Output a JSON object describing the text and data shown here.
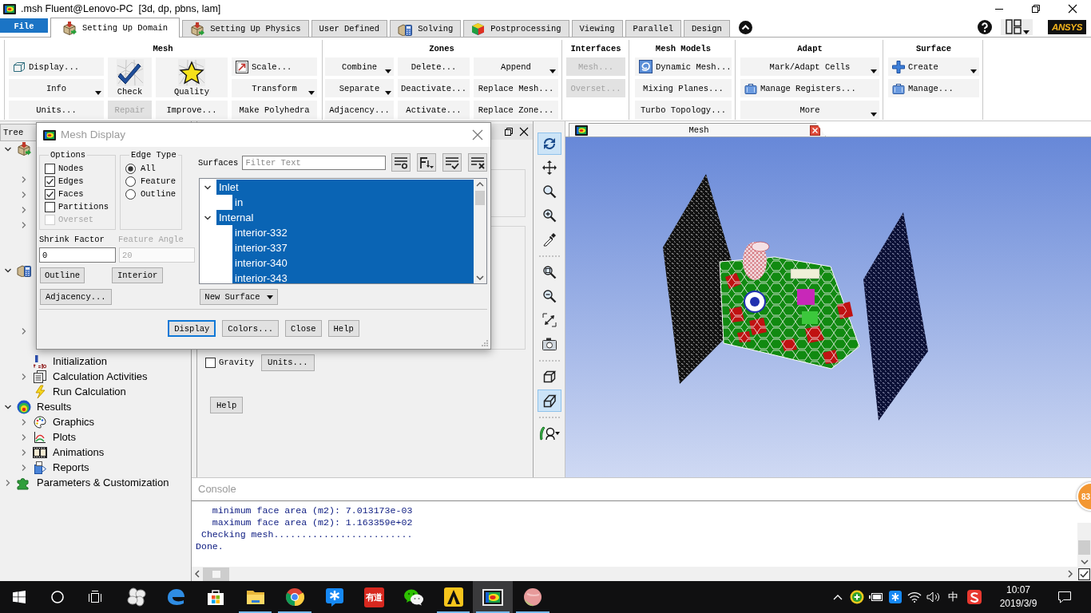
{
  "window": {
    "title": ".msh Fluent@Lenovo-PC  [3d, dp, pbns, lam]"
  },
  "ribbon_tabs": [
    {
      "label": "File",
      "kind": "file",
      "selected": false
    },
    {
      "label": "Setting Up Domain",
      "kind": "tab",
      "selected": true
    },
    {
      "label": "Setting Up Physics",
      "kind": "tab",
      "selected": false
    },
    {
      "label": "User Defined",
      "kind": "tab",
      "selected": false
    },
    {
      "label": "Solving",
      "kind": "tab",
      "selected": false
    },
    {
      "label": "Postprocessing",
      "kind": "tab",
      "selected": false
    },
    {
      "label": "Viewing",
      "kind": "tab",
      "selected": false
    },
    {
      "label": "Parallel",
      "kind": "tab",
      "selected": false
    },
    {
      "label": "Design",
      "kind": "tab",
      "selected": false
    }
  ],
  "logo": "ANSYS",
  "ribbon_groups": [
    {
      "title": "Mesh",
      "columns": [
        [
          {
            "label": "Display...",
            "kind": "small",
            "menu": false,
            "disabled": false
          },
          {
            "label": "Info",
            "kind": "small",
            "menu": true,
            "disabled": false
          },
          {
            "label": "Units...",
            "kind": "small",
            "menu": false,
            "disabled": false
          }
        ],
        [
          {
            "label": "Check",
            "kind": "large",
            "menu": false,
            "disabled": false
          },
          {
            "label": "Repair",
            "kind": "small",
            "menu": false,
            "disabled": true
          }
        ],
        [
          {
            "label": "Quality",
            "kind": "large",
            "menu": false,
            "disabled": false
          },
          {
            "label": "Improve...",
            "kind": "small",
            "menu": false,
            "disabled": false
          }
        ],
        [
          {
            "label": "Scale...",
            "kind": "small",
            "menu": false,
            "disabled": false
          },
          {
            "label": "Transform",
            "kind": "small",
            "menu": true,
            "disabled": false
          },
          {
            "label": "Make Polyhedra",
            "kind": "small",
            "menu": false,
            "disabled": false
          }
        ]
      ]
    },
    {
      "title": "Zones",
      "columns": [
        [
          {
            "label": "Combine",
            "kind": "small",
            "menu": true,
            "disabled": false
          },
          {
            "label": "Separate",
            "kind": "small",
            "menu": true,
            "disabled": false
          },
          {
            "label": "Adjacency...",
            "kind": "small",
            "menu": false,
            "disabled": false
          }
        ],
        [
          {
            "label": "Delete...",
            "kind": "small",
            "menu": false,
            "disabled": false
          },
          {
            "label": "Deactivate...",
            "kind": "small",
            "menu": false,
            "disabled": false
          },
          {
            "label": "Activate...",
            "kind": "small",
            "menu": false,
            "disabled": false
          }
        ],
        [
          {
            "label": "Append",
            "kind": "small",
            "menu": true,
            "disabled": false
          },
          {
            "label": "Replace Mesh...",
            "kind": "small",
            "menu": false,
            "disabled": false
          },
          {
            "label": "Replace Zone...",
            "kind": "small",
            "menu": false,
            "disabled": false
          }
        ]
      ]
    },
    {
      "title": "Interfaces",
      "columns": [
        [
          {
            "label": "Mesh...",
            "kind": "small",
            "menu": false,
            "disabled": true
          },
          {
            "label": "Overset...",
            "kind": "small",
            "menu": false,
            "disabled": true
          }
        ]
      ]
    },
    {
      "title": "Mesh Models",
      "columns": [
        [
          {
            "label": "Dynamic Mesh...",
            "kind": "small",
            "menu": false,
            "disabled": false
          },
          {
            "label": "Mixing Planes...",
            "kind": "small",
            "menu": false,
            "disabled": false
          },
          {
            "label": "Turbo Topology...",
            "kind": "small",
            "menu": false,
            "disabled": false
          }
        ]
      ]
    },
    {
      "title": "Adapt",
      "columns": [
        [
          {
            "label": "Mark/Adapt Cells",
            "kind": "small",
            "menu": true,
            "disabled": false
          },
          {
            "label": "Manage Registers...",
            "kind": "small",
            "menu": false,
            "disabled": false
          },
          {
            "label": "More",
            "kind": "small",
            "menu": true,
            "disabled": false
          }
        ]
      ]
    },
    {
      "title": "Surface",
      "columns": [
        [
          {
            "label": "Create",
            "kind": "small",
            "menu": true,
            "disabled": false
          },
          {
            "label": "Manage...",
            "kind": "small",
            "menu": false,
            "disabled": false
          }
        ]
      ]
    }
  ],
  "tree_title": "Tree",
  "tree": [
    {
      "expanded": true,
      "children": [
        {
          "expanded": false
        },
        {
          "expanded": false
        },
        {
          "expanded": false
        },
        {
          "expanded": false
        }
      ]
    },
    {
      "expanded": true,
      "children": [
        {
          "expanded": false
        },
        {
          "label": "Initialization"
        },
        {
          "label": "Calculation Activities",
          "expanded": false
        },
        {
          "label": "Run Calculation"
        }
      ]
    },
    {
      "label": "Results",
      "expanded": true,
      "children": [
        {
          "label": "Graphics",
          "expanded": false
        },
        {
          "label": "Plots",
          "expanded": false
        },
        {
          "label": "Animations",
          "expanded": false
        },
        {
          "label": "Reports",
          "expanded": false
        }
      ]
    },
    {
      "label": "Parameters & Customization",
      "expanded": false
    }
  ],
  "task_page": {
    "gravity": {
      "label": "Gravity",
      "checked": false
    },
    "units_button": "Units...",
    "help_button": "Help"
  },
  "graphics_toolbar": [
    [
      {
        "selected": true
      },
      {
        "selected": false
      },
      {
        "selected": false
      },
      {
        "selected": false
      },
      {
        "selected": false
      }
    ],
    [
      {
        "selected": false
      },
      {
        "selected": false
      },
      {
        "selected": false
      },
      {
        "selected": false
      }
    ],
    [
      {
        "selected": false
      },
      {
        "selected": true
      }
    ],
    [
      {
        "selected": false
      }
    ]
  ],
  "graphics_window": {
    "tab": "Mesh"
  },
  "console": {
    "title": "Console",
    "lines": [
      "   minimum face area (m2): 7.013173e-03",
      "   maximum face area (m2): 1.163359e+02",
      " Checking mesh.........................",
      "Done."
    ],
    "corner_checkbox": {
      "checked": true
    }
  },
  "floating_badge": "83",
  "dialog": {
    "title": "Mesh Display",
    "options": {
      "title": "Options",
      "items": [
        {
          "label": "Nodes",
          "checked": false,
          "disabled": false
        },
        {
          "label": "Edges",
          "checked": true,
          "disabled": false
        },
        {
          "label": "Faces",
          "checked": true,
          "disabled": false
        },
        {
          "label": "Partitions",
          "checked": false,
          "disabled": false
        },
        {
          "label": "Overset",
          "checked": false,
          "disabled": true
        }
      ]
    },
    "edge_type": {
      "title": "Edge Type",
      "items": [
        {
          "label": "All",
          "selected": true
        },
        {
          "label": "Feature",
          "selected": false
        },
        {
          "label": "Outline",
          "selected": false
        }
      ]
    },
    "shrink_factor": {
      "label": "Shrink Factor",
      "value": "0",
      "disabled": false
    },
    "feature_angle": {
      "label": "Feature Angle",
      "value": "20",
      "disabled": true
    },
    "left_buttons": [
      "Outline",
      "Interior",
      "Adjacency..."
    ],
    "surfaces": {
      "label": "Surfaces",
      "placeholder": "Filter Text",
      "items": [
        {
          "label": "Inlet",
          "selected": true,
          "expanded": true,
          "children": [
            {
              "label": "in",
              "selected": true
            }
          ]
        },
        {
          "label": "Internal",
          "selected": true,
          "expanded": true,
          "children": [
            {
              "label": "interior-332",
              "selected": true
            },
            {
              "label": "interior-337",
              "selected": true
            },
            {
              "label": "interior-340",
              "selected": true
            },
            {
              "label": "interior-343",
              "selected": true
            }
          ]
        }
      ]
    },
    "new_surface": "New Surface",
    "footer_buttons": [
      {
        "label": "Display",
        "focused": true
      },
      {
        "label": "Colors...",
        "focused": false
      },
      {
        "label": "Close",
        "focused": false
      },
      {
        "label": "Help",
        "focused": false
      }
    ]
  },
  "taskbar": {
    "apps": [
      {
        "running": false,
        "selected": false
      },
      {
        "running": false,
        "selected": false
      },
      {
        "running": false,
        "selected": false
      },
      {
        "running": true,
        "selected": false
      },
      {
        "running": true,
        "selected": false
      },
      {
        "running": false,
        "selected": false
      },
      {
        "text": "有道",
        "running": false,
        "selected": false
      },
      {
        "running": false,
        "selected": false
      },
      {
        "running": true,
        "selected": false
      },
      {
        "running": true,
        "selected": true
      },
      {
        "running": true,
        "selected": false
      }
    ],
    "ime": "中",
    "time": "10:07",
    "date": "2019/3/9"
  }
}
